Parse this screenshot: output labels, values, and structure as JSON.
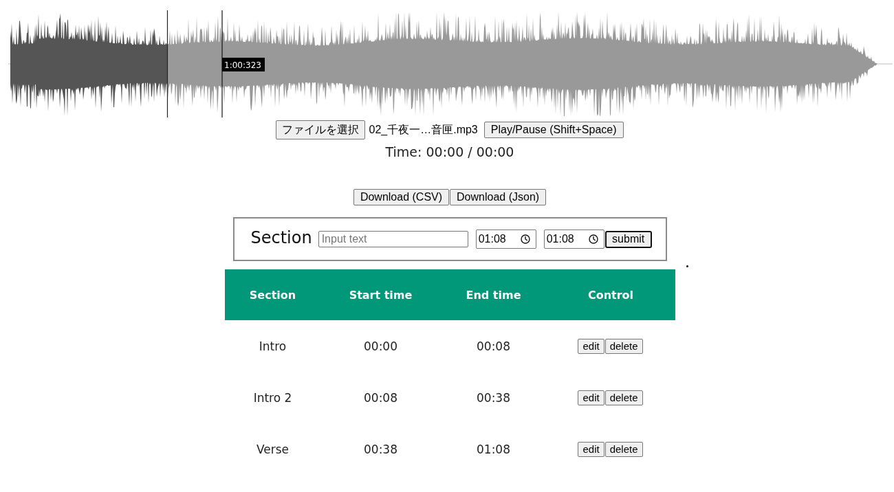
{
  "waveform": {
    "level": 0.18,
    "hover_time": "1:00:323"
  },
  "file_picker": {
    "button": "ファイルを選択",
    "file_name": "02_千夜一…音匣.mp3"
  },
  "play_button": "Play/Pause (Shift+Space)",
  "time": "Time: 00:00 / 00:00",
  "download_buttons": [
    "Download (CSV)",
    "Download (Json)"
  ],
  "section_form": {
    "label": "Section",
    "name_field": {
      "placeholder": "Input text"
    },
    "start_field": {
      "value": "01:08"
    },
    "end_field": {
      "value": "01:08"
    },
    "submit": "submit"
  },
  "table": {
    "columns": [
      "Section",
      "Start time",
      "End time",
      "Control"
    ],
    "rows": [
      {
        "cells": [
          "Intro",
          "00:00",
          "00:08"
        ],
        "actions": [
          "edit",
          "delete"
        ]
      },
      {
        "cells": [
          "Intro 2",
          "00:08",
          "00:38"
        ],
        "actions": [
          "edit",
          "delete"
        ]
      },
      {
        "cells": [
          "Verse",
          "00:38",
          "01:08"
        ],
        "actions": [
          "edit",
          "delete"
        ]
      }
    ]
  }
}
